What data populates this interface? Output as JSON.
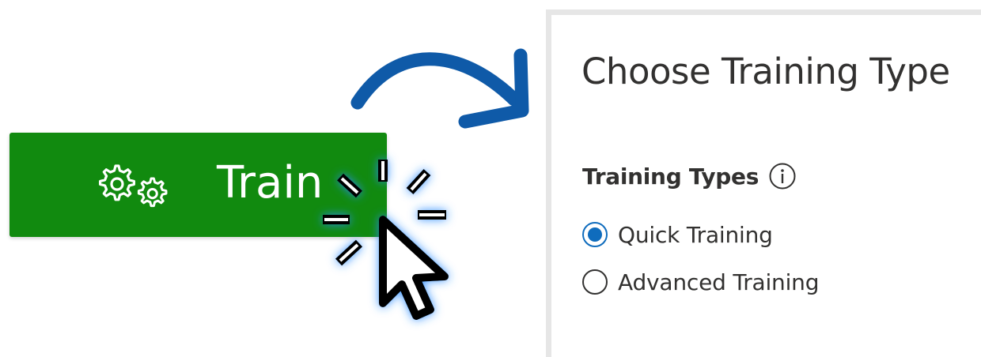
{
  "train_button": {
    "label": "Train",
    "icon": "gears-icon",
    "background_color": "#118a0f"
  },
  "arrow": {
    "icon": "curved-arrow-right-icon",
    "color": "#0f5aa8"
  },
  "cursor": {
    "icon": "pointer-cursor-icon",
    "effect": "click-burst",
    "glow_color": "#2b8cff"
  },
  "panel": {
    "title": "Choose Training Type",
    "group_label": "Training Types",
    "info_icon": "info-icon",
    "options": [
      {
        "label": "Quick Training",
        "selected": true
      },
      {
        "label": "Advanced Training",
        "selected": false
      }
    ],
    "accent_color": "#0f6cbd"
  }
}
